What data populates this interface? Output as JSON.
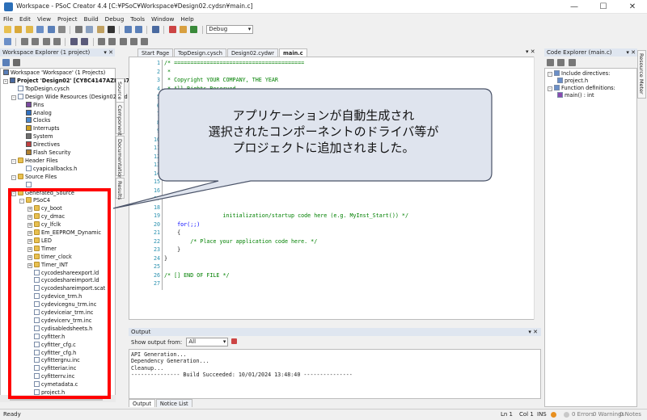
{
  "window": {
    "title": "Workspace - PSoC Creator 4.4  [C:¥PSoC¥Workspace¥Design02.cydsn¥main.c]",
    "minimize": "—",
    "maximize": "☐",
    "close": "✕"
  },
  "menu": [
    "File",
    "Edit",
    "View",
    "Project",
    "Build",
    "Debug",
    "Tools",
    "Window",
    "Help"
  ],
  "toolbar": {
    "config": "Debug"
  },
  "workspace_explorer": {
    "title": "Workspace Explorer (1 project)",
    "items": [
      {
        "text": "Workspace 'Workspace' (1 Projects)",
        "lvl": 0,
        "exp": "",
        "icon": "ws"
      },
      {
        "text": "Project 'Design02' [CY8C4147AZI-S475]",
        "lvl": 0,
        "exp": "-",
        "icon": "proj",
        "bold": true
      },
      {
        "text": "TopDesign.cysch",
        "lvl": 1,
        "exp": "",
        "icon": "file"
      },
      {
        "text": "Design Wide Resources (Design02.cyd",
        "lvl": 1,
        "exp": "-",
        "icon": "file"
      },
      {
        "text": "Pins",
        "lvl": 2,
        "exp": "",
        "icon": "pins"
      },
      {
        "text": "Analog",
        "lvl": 2,
        "exp": "",
        "icon": "analog"
      },
      {
        "text": "Clocks",
        "lvl": 2,
        "exp": "",
        "icon": "clock"
      },
      {
        "text": "Interrupts",
        "lvl": 2,
        "exp": "",
        "icon": "irq"
      },
      {
        "text": "System",
        "lvl": 2,
        "exp": "",
        "icon": "sys"
      },
      {
        "text": "Directives",
        "lvl": 2,
        "exp": "",
        "icon": "dir"
      },
      {
        "text": "Flash Security",
        "lvl": 2,
        "exp": "",
        "icon": "flash"
      },
      {
        "text": "Header Files",
        "lvl": 1,
        "exp": "-",
        "icon": "folder"
      },
      {
        "text": "cyapicallbacks.h",
        "lvl": 2,
        "exp": "",
        "icon": "file"
      },
      {
        "text": "Source Files",
        "lvl": 1,
        "exp": "-",
        "icon": "folder"
      },
      {
        "text": "",
        "lvl": 2,
        "exp": "",
        "icon": "file"
      },
      {
        "text": "Generated_Source",
        "lvl": 1,
        "exp": "-",
        "icon": "folder"
      },
      {
        "text": "PSoC4",
        "lvl": 2,
        "exp": "-",
        "icon": "folder"
      },
      {
        "text": "cy_boot",
        "lvl": 3,
        "exp": "+",
        "icon": "folder"
      },
      {
        "text": "cy_dmac",
        "lvl": 3,
        "exp": "+",
        "icon": "folder"
      },
      {
        "text": "cy_lfclk",
        "lvl": 3,
        "exp": "+",
        "icon": "folder"
      },
      {
        "text": "Em_EEPROM_Dynamic",
        "lvl": 3,
        "exp": "+",
        "icon": "folder"
      },
      {
        "text": "LED",
        "lvl": 3,
        "exp": "+",
        "icon": "folder"
      },
      {
        "text": "Timer",
        "lvl": 3,
        "exp": "+",
        "icon": "folder"
      },
      {
        "text": "timer_clock",
        "lvl": 3,
        "exp": "+",
        "icon": "folder"
      },
      {
        "text": "Timer_INT",
        "lvl": 3,
        "exp": "+",
        "icon": "folder"
      },
      {
        "text": "cycodeshareexport.ld",
        "lvl": 3,
        "exp": "",
        "icon": "file"
      },
      {
        "text": "cycodeshareimport.ld",
        "lvl": 3,
        "exp": "",
        "icon": "file"
      },
      {
        "text": "cycodeshareimport.scat",
        "lvl": 3,
        "exp": "",
        "icon": "file"
      },
      {
        "text": "cydevice_trm.h",
        "lvl": 3,
        "exp": "",
        "icon": "file"
      },
      {
        "text": "cydevicegnu_trm.inc",
        "lvl": 3,
        "exp": "",
        "icon": "file"
      },
      {
        "text": "cydeviceiar_trm.inc",
        "lvl": 3,
        "exp": "",
        "icon": "file"
      },
      {
        "text": "cydevicerv_trm.inc",
        "lvl": 3,
        "exp": "",
        "icon": "file"
      },
      {
        "text": "cydisabledsheets.h",
        "lvl": 3,
        "exp": "",
        "icon": "file"
      },
      {
        "text": "cyfitter.h",
        "lvl": 3,
        "exp": "",
        "icon": "file"
      },
      {
        "text": "cyfitter_cfg.c",
        "lvl": 3,
        "exp": "",
        "icon": "cfile"
      },
      {
        "text": "cyfitter_cfg.h",
        "lvl": 3,
        "exp": "",
        "icon": "file"
      },
      {
        "text": "cyfittergnu.inc",
        "lvl": 3,
        "exp": "",
        "icon": "file"
      },
      {
        "text": "cyfitteriar.inc",
        "lvl": 3,
        "exp": "",
        "icon": "file"
      },
      {
        "text": "cyfitterrv.inc",
        "lvl": 3,
        "exp": "",
        "icon": "file"
      },
      {
        "text": "cymetadata.c",
        "lvl": 3,
        "exp": "",
        "icon": "cfile"
      },
      {
        "text": "project.h",
        "lvl": 3,
        "exp": "",
        "icon": "file"
      }
    ]
  },
  "side_tabs": [
    "Source",
    "Components",
    "Documentation",
    "Results"
  ],
  "editor": {
    "tabs": [
      "Start Page",
      "TopDesign.cysch",
      "Design02.cydwr",
      "main.c"
    ],
    "active_tab": 3,
    "lines": [
      {
        "n": "1",
        "t": "/* ========================================",
        "c": "cmt"
      },
      {
        "n": "2",
        "t": " *",
        "c": "cmt"
      },
      {
        "n": "3",
        "t": " * Copyright YOUR COMPANY, THE YEAR",
        "c": "cmt"
      },
      {
        "n": "4",
        "t": " * All Rights Reserved",
        "c": "cmt"
      },
      {
        "n": "5",
        "t": "",
        "c": ""
      },
      {
        "n": "6",
        "t": "",
        "c": ""
      },
      {
        "n": "7",
        "t": "",
        "c": ""
      },
      {
        "n": "8",
        "t": "",
        "c": ""
      },
      {
        "n": "9",
        "t": "",
        "c": ""
      },
      {
        "n": "10",
        "t": "",
        "c": ""
      },
      {
        "n": "11",
        "t": "",
        "c": ""
      },
      {
        "n": "12",
        "t": "",
        "c": ""
      },
      {
        "n": "13",
        "t": "",
        "c": ""
      },
      {
        "n": "14",
        "t": "",
        "c": ""
      },
      {
        "n": "15",
        "t": "",
        "c": ""
      },
      {
        "n": "16",
        "t": "",
        "c": ""
      },
      {
        "n": "17",
        "t": "",
        "c": ""
      },
      {
        "n": "18",
        "t": "",
        "c": ""
      },
      {
        "n": "19",
        "t": "                  initialization/startup code here (e.g. MyInst_Start()) */",
        "c": "cmt"
      },
      {
        "n": "20",
        "t": "    for(;;)",
        "c": "kw"
      },
      {
        "n": "21",
        "t": "    {",
        "c": ""
      },
      {
        "n": "22",
        "t": "        /* Place your application code here. */",
        "c": "cmt"
      },
      {
        "n": "23",
        "t": "    }",
        "c": ""
      },
      {
        "n": "24",
        "t": "}",
        "c": ""
      },
      {
        "n": "25",
        "t": "",
        "c": ""
      },
      {
        "n": "26",
        "t": "/* [] END OF FILE */",
        "c": "cmt"
      },
      {
        "n": "27",
        "t": "",
        "c": ""
      }
    ]
  },
  "callout": {
    "line1": "アプリケーションが自動生成され",
    "line2": "選択されたコンポーネントのドライバ等が",
    "line3": "プロジェクトに追加されました。"
  },
  "output": {
    "title": "Output",
    "show_from_label": "Show output from:",
    "show_from_value": "All",
    "lines": [
      "API Generation...",
      "Dependency Generation...",
      "Cleanup...",
      "--------------- Build Succeeded: 10/01/2024 13:48:40 ---------------"
    ],
    "tabs": [
      "Output",
      "Notice List"
    ]
  },
  "code_explorer": {
    "title": "Code Explorer (main.c)",
    "items": [
      {
        "text": "Include directives:",
        "lvl": 0,
        "exp": "-"
      },
      {
        "text": "project.h",
        "lvl": 1,
        "exp": ""
      },
      {
        "text": "Function definitions:",
        "lvl": 0,
        "exp": "-"
      },
      {
        "text": "main() : int",
        "lvl": 1,
        "exp": ""
      }
    ]
  },
  "right_tab": "Resource Meter",
  "status": {
    "left": "Ready",
    "ln": "Ln 1",
    "col": "Col 1",
    "ins": "INS",
    "errors": "0 Errors",
    "warnings": "0 Warnings",
    "notes": "0 Notes"
  },
  "colors": {
    "highlight_box": "#ff0000",
    "callout_bg": "#dfe4ee",
    "callout_border": "#4a5368"
  }
}
